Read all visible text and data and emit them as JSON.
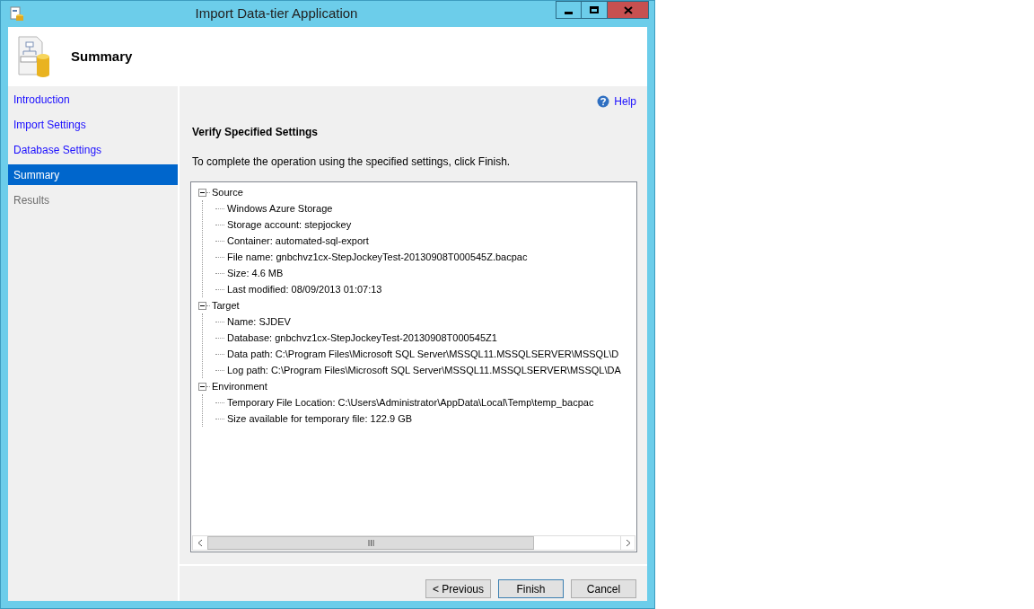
{
  "window": {
    "title": "Import Data-tier Application"
  },
  "header": {
    "title": "Summary"
  },
  "sidebar": {
    "items": [
      {
        "label": "Introduction",
        "selected": false,
        "disabled": false
      },
      {
        "label": "Import Settings",
        "selected": false,
        "disabled": false
      },
      {
        "label": "Database Settings",
        "selected": false,
        "disabled": false
      },
      {
        "label": "Summary",
        "selected": true,
        "disabled": false
      },
      {
        "label": "Results",
        "selected": false,
        "disabled": true
      }
    ]
  },
  "help": {
    "label": "Help"
  },
  "heading": "Verify Specified Settings",
  "instruction": "To complete the operation using the specified settings, click Finish.",
  "tree": [
    {
      "label": "Source",
      "expanded": true,
      "children": [
        {
          "label": "Windows Azure Storage"
        },
        {
          "label": "Storage account: stepjockey"
        },
        {
          "label": "Container: automated-sql-export"
        },
        {
          "label": "File name: gnbchvz1cx-StepJockeyTest-20130908T000545Z.bacpac"
        },
        {
          "label": "Size: 4.6 MB"
        },
        {
          "label": "Last modified: 08/09/2013 01:07:13"
        }
      ]
    },
    {
      "label": "Target",
      "expanded": true,
      "children": [
        {
          "label": "Name: SJDEV"
        },
        {
          "label": "Database: gnbchvz1cx-StepJockeyTest-20130908T000545Z1"
        },
        {
          "label": "Data path: C:\\Program Files\\Microsoft SQL Server\\MSSQL11.MSSQLSERVER\\MSSQL\\D"
        },
        {
          "label": "Log path: C:\\Program Files\\Microsoft SQL Server\\MSSQL11.MSSQLSERVER\\MSSQL\\DA"
        }
      ]
    },
    {
      "label": "Environment",
      "expanded": true,
      "children": [
        {
          "label": "Temporary File Location: C:\\Users\\Administrator\\AppData\\Local\\Temp\\temp_bacpac"
        },
        {
          "label": "Size available for temporary file: 122.9 GB"
        }
      ]
    }
  ],
  "buttons": [
    {
      "label": "< Previous",
      "default": false
    },
    {
      "label": "Finish",
      "default": true
    },
    {
      "label": "Cancel",
      "default": false
    }
  ]
}
